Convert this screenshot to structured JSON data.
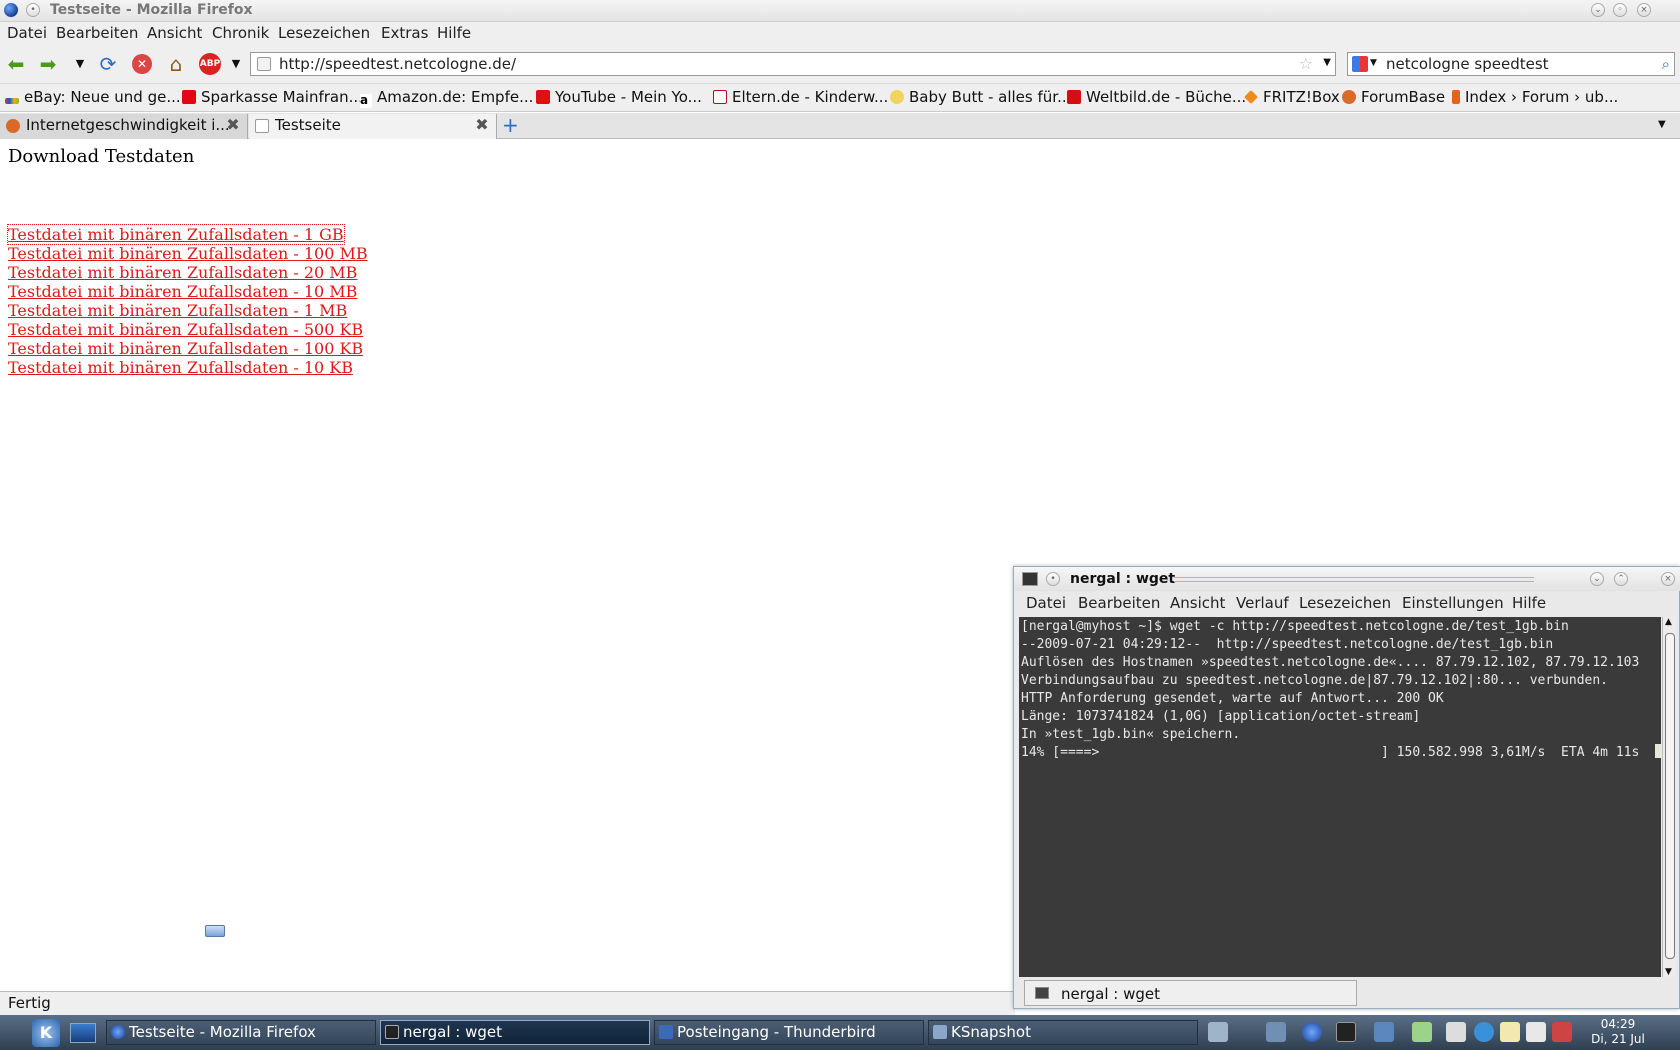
{
  "firefox": {
    "title": "Testseite - Mozilla Firefox",
    "menu": [
      "Datei",
      "Bearbeiten",
      "Ansicht",
      "Chronik",
      "Lesezeichen",
      "Extras",
      "Hilfe"
    ],
    "url": "http://speedtest.netcologne.de/",
    "search_value": "netcologne speedtest",
    "adblock_label": "ABP",
    "bookmarks": [
      "eBay: Neue und ge...",
      "Sparkasse Mainfran...",
      "Amazon.de: Empfe...",
      "YouTube - Mein Yo...",
      "Eltern.de - Kinderw...",
      "Baby Butt - alles für...",
      "Weltbild.de - Büche...",
      "FRITZ!Box",
      "ForumBase",
      "Index › Forum › ub..."
    ],
    "tabs": [
      "Internetgeschwindigkeit i...",
      "Testseite"
    ],
    "status": "Fertig"
  },
  "page": {
    "heading": "Download Testdaten",
    "links": [
      "Testdatei mit binären Zufallsdaten - 1 GB",
      "Testdatei mit binären Zufallsdaten - 100 MB",
      "Testdatei mit binären Zufallsdaten - 20 MB",
      "Testdatei mit binären Zufallsdaten - 10 MB",
      "Testdatei mit binären Zufallsdaten - 1 MB",
      "Testdatei mit binären Zufallsdaten - 500 KB",
      "Testdatei mit binären Zufallsdaten - 100 KB",
      "Testdatei mit binären Zufallsdaten - 10 KB"
    ]
  },
  "konsole": {
    "title": "nergal : wget",
    "menu": [
      "Datei",
      "Bearbeiten",
      "Ansicht",
      "Verlauf",
      "Lesezeichen",
      "Einstellungen",
      "Hilfe"
    ],
    "lines": [
      "[nergal@myhost ~]$ wget -c http://speedtest.netcologne.de/test_1gb.bin",
      "--2009-07-21 04:29:12--  http://speedtest.netcologne.de/test_1gb.bin",
      "Auflösen des Hostnamen »speedtest.netcologne.de«.... 87.79.12.102, 87.79.12.103",
      "Verbindungsaufbau zu speedtest.netcologne.de|87.79.12.102|:80... verbunden.",
      "HTTP Anforderung gesendet, warte auf Antwort... 200 OK",
      "Länge: 1073741824 (1,0G) [application/octet-stream]",
      "In »test_1gb.bin« speichern.",
      "",
      "14% [====>                                    ] 150.582.998 3,61M/s  ETA 4m 11s  "
    ],
    "tab_label": "nergal : wget"
  },
  "taskbar": {
    "tasks": [
      "Testseite - Mozilla Firefox",
      "nergal : wget",
      "Posteingang - Thunderbird",
      "KSnapshot"
    ],
    "clock_time": "04:29",
    "clock_date": "Di, 21 Jul"
  }
}
